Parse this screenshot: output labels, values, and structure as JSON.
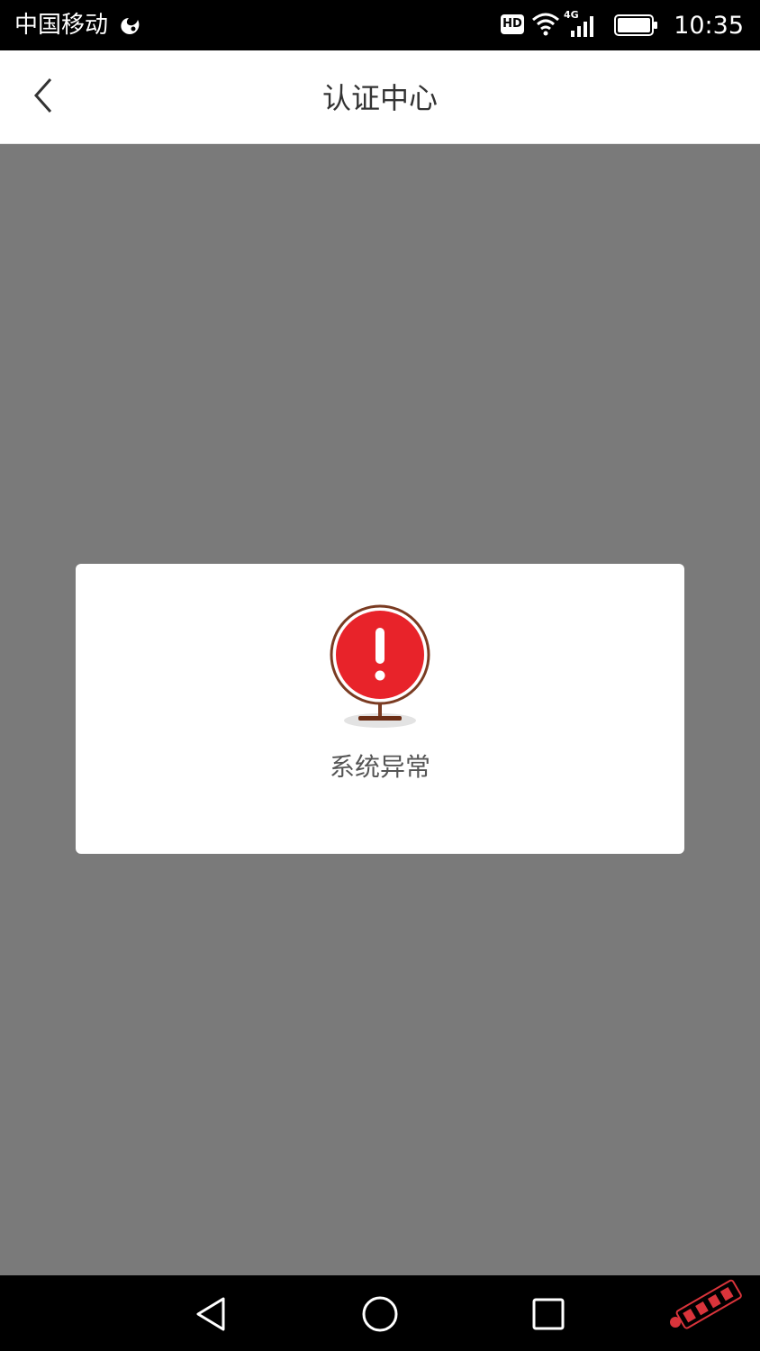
{
  "status_bar": {
    "carrier": "中国移动",
    "hd_label": "HD",
    "network_type": "4G",
    "time": "10:35",
    "icons": [
      "uc-browser-icon",
      "wifi-icon",
      "signal-icon",
      "battery-icon"
    ]
  },
  "nav_bar": {
    "back_icon": "chevron-left-icon",
    "title": "认证中心"
  },
  "dialog": {
    "icon": "alert-exclamation-icon",
    "message": "系统异常"
  },
  "system_nav": {
    "buttons": [
      "back-triangle-icon",
      "home-circle-icon",
      "recent-square-icon"
    ]
  },
  "colors": {
    "overlay": "#7a7a7a",
    "alert_red": "#e8232a",
    "alert_ring": "#7a3b22",
    "status_bar": "#000000"
  }
}
